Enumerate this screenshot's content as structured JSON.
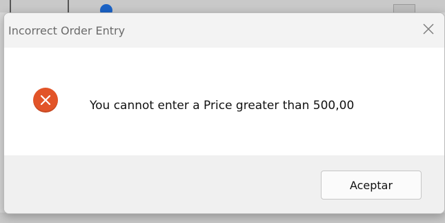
{
  "dialog": {
    "title": "Incorrect Order Entry",
    "close_icon": "close-icon",
    "message": "You cannot enter a Price greater than 500,00",
    "icon": "error-icon",
    "ok_label": "Aceptar"
  },
  "colors": {
    "error_icon": "#e25428",
    "title_text": "#6a6a6a",
    "footer_bg": "#f0f0f0"
  }
}
